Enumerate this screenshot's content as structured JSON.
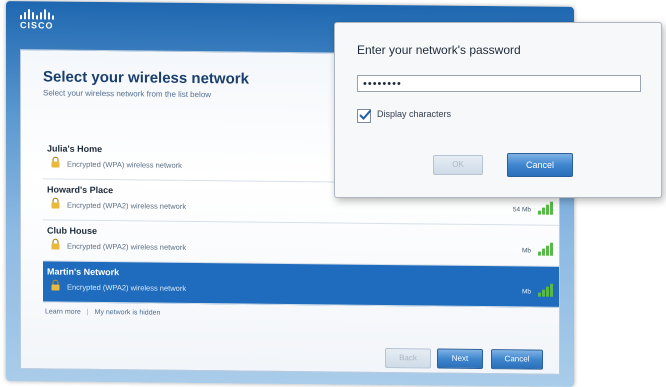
{
  "logo": {
    "text": "CISCO"
  },
  "wizard": {
    "title": "Select your wireless network",
    "subtitle": "Select your wireless network from the list below",
    "networks": [
      {
        "name": "Julia's Home",
        "description": "Encrypted (WPA) wireless network",
        "speed": "",
        "signal": 0
      },
      {
        "name": "Howard's Place",
        "description": "Encrypted (WPA2) wireless network",
        "speed": "54 Mb",
        "signal": 4
      },
      {
        "name": "Club House",
        "description": "Encrypted (WPA2) wireless network",
        "speed": "Mb",
        "signal": 4
      },
      {
        "name": "Martin's Network",
        "description": "Encrypted (WPA2) wireless network",
        "speed": "Mb",
        "signal": 4,
        "selected": true
      }
    ],
    "links": {
      "learn_more": "Learn more",
      "not_listed": "My network is hidden"
    },
    "buttons": {
      "back": "Back",
      "next": "Next",
      "cancel": "Cancel"
    }
  },
  "password_dialog": {
    "title": "Enter your network's password",
    "password_value": "••••••••",
    "display_characters_label": "Display characters",
    "display_characters_checked": true,
    "ok_label": "OK",
    "cancel_label": "Cancel"
  },
  "colors": {
    "accent": "#1f6bbd",
    "signal": "#59b84a"
  },
  "icons": [
    "lock-icon",
    "signal-icon",
    "checkmark-icon"
  ]
}
